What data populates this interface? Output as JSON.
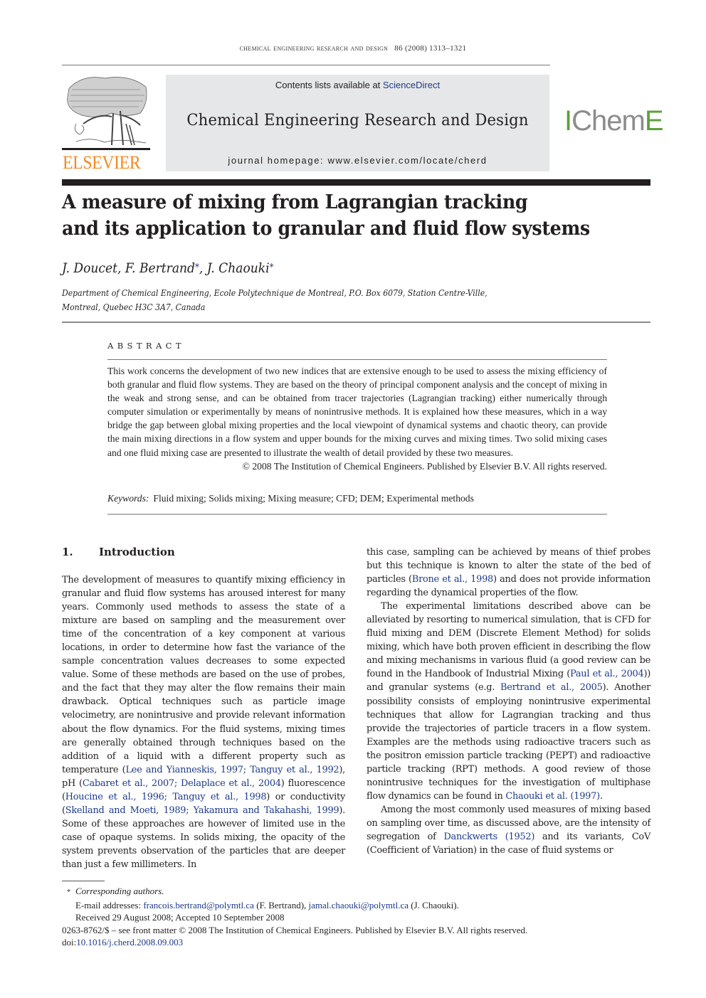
{
  "running_head": {
    "journal": "Chemical Engineering Research and Design",
    "citation": "86 (2008) 1313–1321"
  },
  "banner": {
    "contents_prefix": "Contents lists available at ",
    "contents_link": "ScienceDirect",
    "journal_title": "Chemical Engineering Research and Design",
    "homepage": "journal homepage: www.elsevier.com/locate/cherd",
    "background": "#e6e7e8"
  },
  "publisher_logo": {
    "name": "ELSEVIER",
    "icon": "elsevier-tree-icon",
    "color": "#f28a25"
  },
  "society_logo": {
    "part1": "I",
    "part2": "Chem",
    "part3": "E",
    "green": "#5aa13a",
    "grey": "#8a8c8e"
  },
  "article": {
    "title_line1": "A measure of mixing from Lagrangian tracking",
    "title_line2": "and its application to granular and fluid flow systems",
    "authors": [
      {
        "name": "J. Doucet",
        "corresponding": false,
        "sep": ", "
      },
      {
        "name": "F. Bertrand",
        "corresponding": true,
        "sep": ", "
      },
      {
        "name": "J. Chaouki",
        "corresponding": true,
        "sep": ""
      }
    ],
    "corresponding_mark": "*",
    "affiliation_line1": "Department of Chemical Engineering, Ecole Polytechnique de Montreal, P.O. Box 6079, Station Centre-Ville,",
    "affiliation_line2": "Montreal, Quebec H3C 3A7, Canada"
  },
  "abstract": {
    "heading": "ABSTRACT",
    "text": "This work concerns the development of two new indices that are extensive enough to be used to assess the mixing efficiency of both granular and fluid flow systems. They are based on the theory of principal component analysis and the concept of mixing in the weak and strong sense, and can be obtained from tracer trajectories (Lagrangian tracking) either numerically through computer simulation or experimentally by means of nonintrusive methods. It is explained how these measures, which in a way bridge the gap between global mixing properties and the local viewpoint of dynamical systems and chaotic theory, can provide the main mixing directions in a flow system and upper bounds for the mixing curves and mixing times. Two solid mixing cases and one fluid mixing case are presented to illustrate the wealth of detail provided by these two measures.",
    "copyright": "© 2008 The Institution of Chemical Engineers. Published by Elsevier B.V. All rights reserved.",
    "keywords_label": "Keywords:",
    "keywords": "Fluid mixing; Solids mixing; Mixing measure; CFD; DEM; Experimental methods"
  },
  "section": {
    "number": "1.",
    "title": "Introduction"
  },
  "body": {
    "left_p1": [
      {
        "t": "The development of measures to quantify mixing efficiency in granular and fluid flow systems has aroused interest for many years. Commonly used methods to assess the state of a mixture are based on sampling and the measurement over time of the concentration of a key component at various locations, in order to determine how fast the variance of the sample concentration values decreases to some expected value. Some of these methods are based on the use of probes, and the fact that they may alter the flow remains their main drawback. Optical techniques such as particle image velocimetry, are nonintrusive and provide relevant information about the flow dynamics. For the fluid systems, mixing times are generally obtained through techniques based on the addition of a liquid with a different property such as temperature (",
        "c": false
      },
      {
        "t": "Lee and Yianneskis, 1997; Tanguy et al., 1992",
        "c": true
      },
      {
        "t": "), pH (",
        "c": false
      },
      {
        "t": "Cabaret et al., 2007; Delaplace et al., 2004",
        "c": true
      },
      {
        "t": ") fluorescence (",
        "c": false
      },
      {
        "t": "Houcine et al., 1996; Tanguy et al., 1998",
        "c": true
      },
      {
        "t": ") or conductivity (",
        "c": false
      },
      {
        "t": "Skelland and Moeti, 1989; Yakamura and Takahashi, 1999",
        "c": true
      },
      {
        "t": "). Some of these approaches are however of limited use in the case of opaque systems. In solids mixing, the opacity of the system prevents observation of the particles that are deeper than just a few millimeters. In",
        "c": false
      }
    ],
    "right_p1": [
      {
        "t": "this case, sampling can be achieved by means of thief probes but this technique is known to alter the state of the bed of particles (",
        "c": false
      },
      {
        "t": "Brone et al., 1998",
        "c": true
      },
      {
        "t": ") and does not provide information regarding the dynamical properties of the flow.",
        "c": false
      }
    ],
    "right_p2": [
      {
        "t": "The experimental limitations described above can be alleviated by resorting to numerical simulation, that is CFD for fluid mixing and DEM (Discrete Element Method) for solids mixing, which have both proven efficient in describing the flow and mixing mechanisms in various fluid (a good review can be found in the Handbook of Industrial Mixing (",
        "c": false
      },
      {
        "t": "Paul et al., 2004",
        "c": true
      },
      {
        "t": ")) and granular systems (e.g. ",
        "c": false
      },
      {
        "t": "Bertrand et al., 2005",
        "c": true
      },
      {
        "t": "). Another possibility consists of employing nonintrusive experimental techniques that allow for Lagrangian tracking and thus provide the trajectories of particle tracers in a flow system. Examples are the methods using radioactive tracers such as the positron emission particle tracking (PEPT) and radioactive particle tracking (RPT) methods. A good review of those nonintrusive techniques for the investigation of multiphase flow dynamics can be found in ",
        "c": false
      },
      {
        "t": "Chaouki et al. (1997)",
        "c": true
      },
      {
        "t": ".",
        "c": false
      }
    ],
    "right_p3": [
      {
        "t": "Among the most commonly used measures of mixing based on sampling over time, as discussed above, are the intensity of segregation of ",
        "c": false
      },
      {
        "t": "Danckwerts (1952)",
        "c": true
      },
      {
        "t": " and its variants, CoV (Coefficient of Variation) in the case of fluid systems or",
        "c": false
      }
    ]
  },
  "footnotes": {
    "mark": "*",
    "corresponding": "Corresponding authors.",
    "email_label": "E-mail addresses: ",
    "email1": "francois.bertrand@polymtl.ca",
    "email1_owner": " (F. Bertrand), ",
    "email2": "jamal.chaouki@polymtl.ca",
    "email2_owner": " (J. Chaouki).",
    "received": "Received 29 August 2008; Accepted 10 September 2008",
    "issn_line": "0263-8762/$ – see front matter © 2008 The Institution of Chemical Engineers. Published by Elsevier B.V. All rights reserved.",
    "doi_label": "doi:",
    "doi": "10.1016/j.cherd.2008.09.003"
  },
  "colors": {
    "link": "#1d3a8a",
    "text": "#231f20"
  }
}
